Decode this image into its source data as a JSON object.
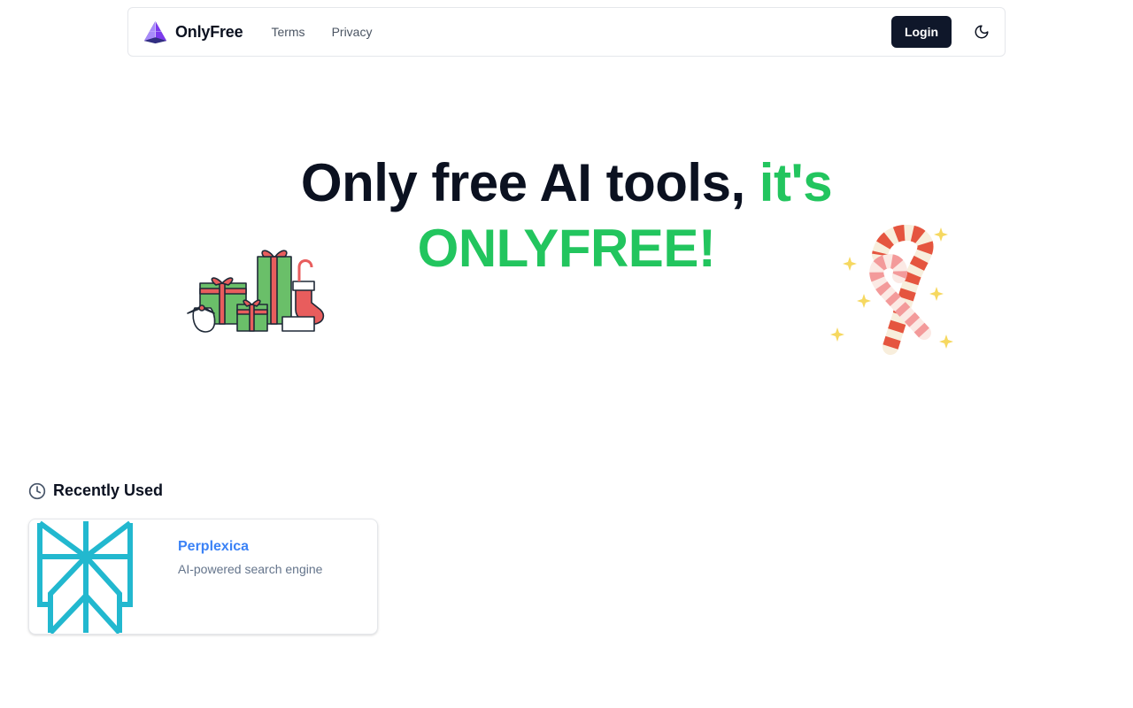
{
  "navbar": {
    "brand_name": "OnlyFree",
    "brand_icon": "pyramid-logo-icon",
    "links": [
      {
        "label": "Terms"
      },
      {
        "label": "Privacy"
      }
    ],
    "login_label": "Login",
    "theme_icon": "moon-icon"
  },
  "hero": {
    "line1_dark": "Only free AI tools,",
    "line1_green": "it's",
    "line2_green": "ONLYFREE!",
    "accent_color": "#22c55e",
    "decorations": [
      "christmas-gifts-illustration",
      "candy-cane-illustration"
    ]
  },
  "recently_used": {
    "title": "Recently Used",
    "icon": "clock-icon",
    "items": [
      {
        "name": "Perplexica",
        "description": "AI-powered search engine",
        "logo": "perplexica-logo-icon",
        "name_color": "#3b82f6"
      }
    ]
  }
}
